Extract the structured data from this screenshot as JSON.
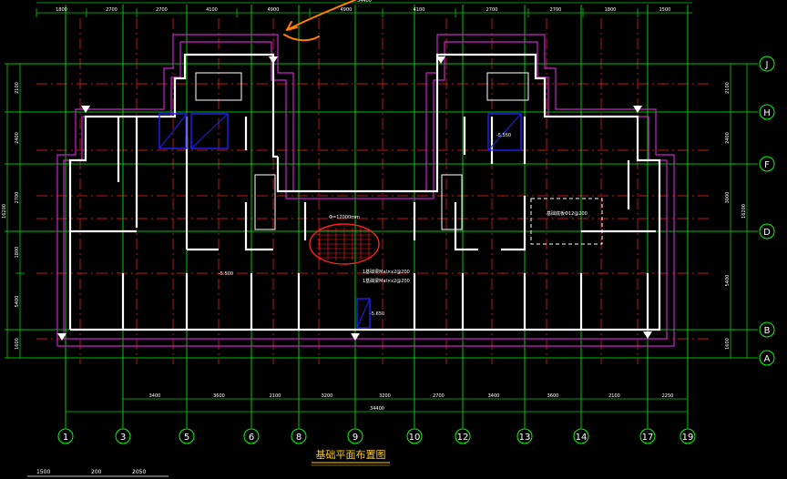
{
  "drawing_title": "基础平面布置图",
  "colors": {
    "background": "#000000",
    "grid_axis": "#00ff00",
    "dim_line": "#00cc00",
    "center_line": "#ff2020",
    "wall": "#ffffff",
    "outline": "#cc22cc",
    "stair": "#2020ff",
    "annotation": "#ffcc00",
    "arrow": "#ff8000",
    "axis_text": "#ffffff"
  },
  "vertical_axes": [
    "1",
    "3",
    "5",
    "6",
    "8",
    "9",
    "10",
    "12",
    "13",
    "14",
    "17",
    "19"
  ],
  "horizontal_axes": [
    "J",
    "H",
    "F",
    "D",
    "B",
    "A"
  ],
  "top_dims": [
    "1800",
    "2700",
    "2700",
    "4100",
    "4900",
    "4900",
    "4100",
    "2700",
    "2700",
    "1800",
    "1500"
  ],
  "top_total": "34400",
  "bottom_dims": [
    "3400",
    "3600",
    "2100",
    "3200",
    "3200",
    "2700",
    "3400",
    "3600",
    "2100",
    "2250"
  ],
  "bottom_total": "34400",
  "left_dims": [
    "2100",
    "2400",
    "2700",
    "1800",
    "5400",
    "1600"
  ],
  "left_total": "16200",
  "right_dims": [
    "2100",
    "2400",
    "3000",
    "5400",
    "1600"
  ],
  "right_total": "16200",
  "scale_bar": [
    "1500",
    "200",
    "2050"
  ],
  "notes": {
    "center_ellipse": "Φ=12000mm",
    "beam_note_1": "1基础梁Mal×x2@200",
    "beam_note_2": "1基础梁Mal×x2@200",
    "elev_left": "-5.500",
    "elev_stair": "-5.550",
    "elev_center": "-5.650",
    "slab_note": "基础底板Φ12@200"
  }
}
